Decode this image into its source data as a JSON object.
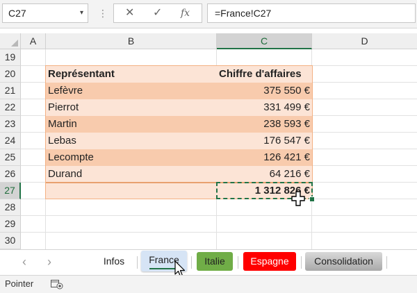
{
  "formula_bar": {
    "name_box": "C27",
    "dropdown_glyph": "▾",
    "more_glyph": "⋮",
    "cancel_glyph": "✕",
    "enter_glyph": "✓",
    "fx_glyph": "fx",
    "formula": "=France!C27"
  },
  "columns": [
    "A",
    "B",
    "C",
    "D"
  ],
  "active_column": "C",
  "rows": [
    "19",
    "20",
    "21",
    "22",
    "23",
    "24",
    "25",
    "26",
    "27",
    "28",
    "29",
    "30"
  ],
  "active_row": "27",
  "table": {
    "header": {
      "representant": "Représentant",
      "ca": "Chiffre d'affaires"
    },
    "records": [
      {
        "name": "Lefèvre",
        "amount": "375 550 €"
      },
      {
        "name": "Pierrot",
        "amount": "331 499 €"
      },
      {
        "name": "Martin",
        "amount": "238 593 €"
      },
      {
        "name": "Lebas",
        "amount": "176 547 €"
      },
      {
        "name": "Lecompte",
        "amount": "126 421 €"
      },
      {
        "name": "Durand",
        "amount": "64 216 €"
      }
    ],
    "total": "1 312 826 €"
  },
  "sheet_tabs": {
    "prev_glyph": "‹",
    "next_glyph": "›",
    "tabs": [
      {
        "label": "Infos",
        "color": "#ffffff"
      },
      {
        "label": "France",
        "color": "#d6e4f5",
        "active": true
      },
      {
        "label": "Italie",
        "color": "#70ad47"
      },
      {
        "label": "Espagne",
        "color": "#ff0000"
      },
      {
        "label": "Consolidation",
        "color": "#bfbfbf"
      }
    ]
  },
  "status_bar": {
    "mode": "Pointer"
  },
  "colors": {
    "accent": "#217346",
    "table_header": "#fce4d6",
    "table_band": "#f8cbad"
  }
}
